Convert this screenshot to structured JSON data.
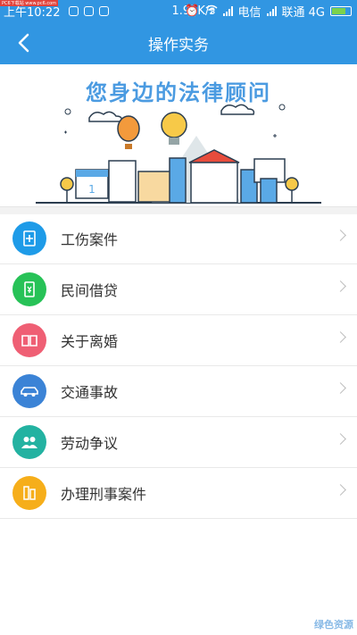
{
  "status_bar": {
    "time": "上午10:22",
    "speed": "1.96K/s",
    "carrier1": "电信",
    "carrier2": "联通 4G",
    "watermark": "PC6下载站 www.pc6.com"
  },
  "header": {
    "title": "操作实务",
    "back_icon": "chevron-left-icon"
  },
  "banner": {
    "title": "您身边的法律顾问"
  },
  "menu": {
    "items": [
      {
        "label": "工伤案件",
        "icon": "document-plus-icon",
        "color": "#1e9be8"
      },
      {
        "label": "民间借贷",
        "icon": "money-note-icon",
        "color": "#27c257"
      },
      {
        "label": "关于离婚",
        "icon": "open-book-icon",
        "color": "#ef5f74"
      },
      {
        "label": "交通事故",
        "icon": "car-icon",
        "color": "#3b83d6"
      },
      {
        "label": "劳动争议",
        "icon": "people-icon",
        "color": "#23b2a1"
      },
      {
        "label": "办理刑事案件",
        "icon": "building-icon",
        "color": "#f6ae1a"
      }
    ]
  },
  "bottom_watermark": "绿色资源"
}
